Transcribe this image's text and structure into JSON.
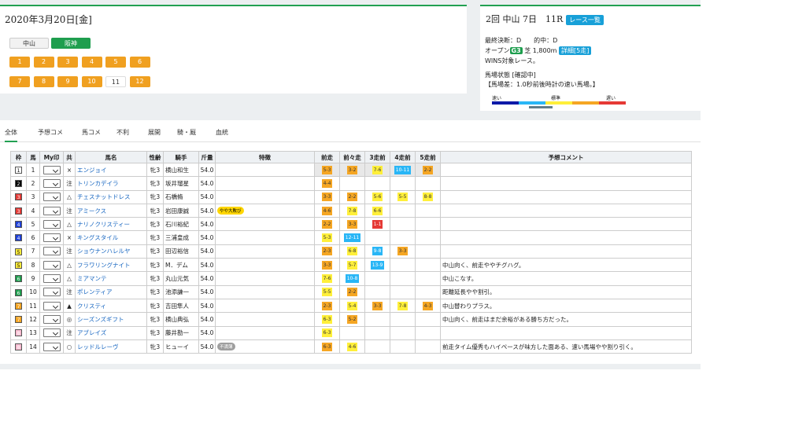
{
  "date": {
    "title": "2020年3月20日[金]"
  },
  "venues": [
    "中山",
    "阪神"
  ],
  "races": [
    "1",
    "2",
    "3",
    "4",
    "5",
    "6",
    "7",
    "8",
    "9",
    "10",
    "11",
    "12"
  ],
  "race": {
    "title": "2回 中山 7日　11R",
    "list_btn": "レース一覧",
    "final": "最終決断：D　　的中：D",
    "open": "オープン",
    "grade": "G3",
    "course": "芝 1,800m",
    "detail": "詳細[5走]",
    "wins": "WINS対象レース。",
    "baba": "馬場状態 [確認中]",
    "baba_note": "【馬場差：1.0秒前後時計の速い馬場。】",
    "scale": [
      "速い",
      "標準",
      "遅い"
    ]
  },
  "tabs": [
    "全体",
    "予想コメ",
    "馬コメ",
    "不利",
    "展開",
    "騎・厩",
    "血統"
  ],
  "headers": [
    "枠",
    "馬",
    "My印",
    "共",
    "馬名",
    "性齢",
    "騎手",
    "斤量",
    "特徴",
    "前走",
    "前々走",
    "3走前",
    "4走前",
    "5走前",
    "予想コメント"
  ],
  "colors": {
    "green": "#1e9e4e",
    "orange": "#f0a020",
    "blue": "#18a0d8"
  },
  "rows": [
    {
      "waku": "1",
      "wc": "#fff",
      "wt": "#000",
      "uma": "1",
      "kyo": "×",
      "name": "エンジョイ",
      "sei": "牝3",
      "jockey": "横山和生",
      "kin": "54.0",
      "feat": "",
      "fc": "",
      "runs": [
        [
          "5-3",
          "#f5a623"
        ],
        [
          "3-2",
          "#f5a623"
        ],
        [
          "7-6",
          "#ffef3a"
        ],
        [
          "10-11",
          "#29b6f6"
        ],
        [
          "2-2",
          "#f5a623"
        ]
      ],
      "cmt": ""
    },
    {
      "waku": "2",
      "wc": "#000",
      "wt": "#fff",
      "uma": "2",
      "kyo": "注",
      "name": "トリンカデイラ",
      "sei": "牝3",
      "jockey": "坂井瑠星",
      "kin": "54.0",
      "feat": "",
      "fc": "",
      "runs": [
        [
          "4-4",
          "#f5a623"
        ],
        [
          "",
          ""
        ],
        [
          "",
          ""
        ],
        [
          "",
          ""
        ],
        [
          "",
          ""
        ]
      ],
      "cmt": ""
    },
    {
      "waku": "3",
      "wc": "#e53935",
      "wt": "#fff",
      "uma": "3",
      "kyo": "△",
      "name": "チェスナットドレス",
      "sei": "牝3",
      "jockey": "石橋脩",
      "kin": "54.0",
      "feat": "",
      "fc": "",
      "runs": [
        [
          "3-3",
          "#f5a623"
        ],
        [
          "2-2",
          "#f5a623"
        ],
        [
          "5-6",
          "#ffef3a"
        ],
        [
          "5-5",
          "#ffef3a"
        ],
        [
          "8-8",
          "#ffef3a"
        ]
      ],
      "cmt": ""
    },
    {
      "waku": "3",
      "wc": "#e53935",
      "wt": "#fff",
      "uma": "4",
      "kyo": "注",
      "name": "アミークス",
      "sei": "牝3",
      "jockey": "岩田康誠",
      "kin": "54.0",
      "feat": "やや大敗び",
      "fc": "#ffd600",
      "runs": [
        [
          "4-6",
          "#f5a623"
        ],
        [
          "7-8",
          "#ffef3a"
        ],
        [
          "6-6",
          "#ffef3a"
        ],
        [
          "",
          ""
        ],
        [
          "",
          ""
        ]
      ],
      "cmt": ""
    },
    {
      "waku": "4",
      "wc": "#1e40d8",
      "wt": "#fff",
      "uma": "5",
      "kyo": "△",
      "name": "ナリノクリスティー",
      "sei": "牝3",
      "jockey": "石川裕紀",
      "kin": "54.0",
      "feat": "",
      "fc": "",
      "runs": [
        [
          "2-2",
          "#f5a623"
        ],
        [
          "3-3",
          "#f5a623"
        ],
        [
          "1-1",
          "#e53935"
        ],
        [
          "",
          ""
        ],
        [
          "",
          ""
        ]
      ],
      "cmt": ""
    },
    {
      "waku": "4",
      "wc": "#1e40d8",
      "wt": "#fff",
      "uma": "6",
      "kyo": "×",
      "name": "キングスタイル",
      "sei": "牝3",
      "jockey": "三浦皇成",
      "kin": "54.0",
      "feat": "",
      "fc": "",
      "runs": [
        [
          "5-3",
          "#ffef3a"
        ],
        [
          "12-11",
          "#29b6f6"
        ],
        [
          "",
          ""
        ],
        [
          "",
          ""
        ],
        [
          "",
          ""
        ]
      ],
      "cmt": ""
    },
    {
      "waku": "5",
      "wc": "#ffeb3b",
      "wt": "#000",
      "uma": "7",
      "kyo": "注",
      "name": "ショウナンハレルヤ",
      "sei": "牝3",
      "jockey": "田辺裕信",
      "kin": "54.0",
      "feat": "",
      "fc": "",
      "runs": [
        [
          "2-3",
          "#f5a623"
        ],
        [
          "6-8",
          "#ffef3a"
        ],
        [
          "9-8",
          "#29b6f6"
        ],
        [
          "3-3",
          "#f5a623"
        ],
        [
          "",
          ""
        ]
      ],
      "cmt": ""
    },
    {
      "waku": "5",
      "wc": "#ffeb3b",
      "wt": "#000",
      "uma": "8",
      "kyo": "△",
      "name": "フラワリングナイト",
      "sei": "牝3",
      "jockey": "M．デム",
      "kin": "54.0",
      "feat": "",
      "fc": "",
      "runs": [
        [
          "3-3",
          "#f5a623"
        ],
        [
          "5-7",
          "#ffef3a"
        ],
        [
          "13-9",
          "#29b6f6"
        ],
        [
          "",
          ""
        ],
        [
          "",
          ""
        ]
      ],
      "cmt": "中山向く、前走ややチグハグ。"
    },
    {
      "waku": "6",
      "wc": "#1e9e4e",
      "wt": "#fff",
      "uma": "9",
      "kyo": "△",
      "name": "ミアマンテ",
      "sei": "牝3",
      "jockey": "丸山元気",
      "kin": "54.0",
      "feat": "",
      "fc": "",
      "runs": [
        [
          "7-6",
          "#ffef3a"
        ],
        [
          "10-8",
          "#29b6f6"
        ],
        [
          "",
          ""
        ],
        [
          "",
          ""
        ],
        [
          "",
          ""
        ]
      ],
      "cmt": "中山こなす。"
    },
    {
      "waku": "6",
      "wc": "#1e9e4e",
      "wt": "#fff",
      "uma": "10",
      "kyo": "注",
      "name": "ポレンティア",
      "sei": "牝3",
      "jockey": "池添謙一",
      "kin": "54.0",
      "feat": "",
      "fc": "",
      "runs": [
        [
          "5-5",
          "#ffef3a"
        ],
        [
          "2-2",
          "#f5a623"
        ],
        [
          "",
          ""
        ],
        [
          "",
          ""
        ],
        [
          "",
          ""
        ]
      ],
      "cmt": "距離延長やや割引。"
    },
    {
      "waku": "7",
      "wc": "#f5a623",
      "wt": "#fff",
      "uma": "11",
      "kyo": "▲",
      "name": "クリスティ",
      "sei": "牝3",
      "jockey": "吉田隼人",
      "kin": "54.0",
      "feat": "",
      "fc": "",
      "runs": [
        [
          "2-3",
          "#f5a623"
        ],
        [
          "5-4",
          "#ffef3a"
        ],
        [
          "3-3",
          "#f5a623"
        ],
        [
          "7-8",
          "#ffef3a"
        ],
        [
          "4-3",
          "#f5a623"
        ]
      ],
      "cmt": "中山替わりプラス。"
    },
    {
      "waku": "7",
      "wc": "#f5a623",
      "wt": "#fff",
      "uma": "12",
      "kyo": "◎",
      "name": "シーズンズギフト",
      "sei": "牝3",
      "jockey": "横山典弘",
      "kin": "54.0",
      "feat": "",
      "fc": "",
      "runs": [
        [
          "6-3",
          "#ffef3a"
        ],
        [
          "5-2",
          "#f5a623"
        ],
        [
          "",
          ""
        ],
        [
          "",
          ""
        ],
        [
          "",
          ""
        ]
      ],
      "cmt": "中山向く、前走はまだ余裕がある勝ち方だった。"
    },
    {
      "waku": "8",
      "wc": "#f8bbd0",
      "wt": "#fff",
      "uma": "13",
      "kyo": "注",
      "name": "アブレイズ",
      "sei": "牝3",
      "jockey": "藤井勘一",
      "kin": "54.0",
      "feat": "",
      "fc": "",
      "runs": [
        [
          "6-3",
          "#ffef3a"
        ],
        [
          "",
          ""
        ],
        [
          "",
          ""
        ],
        [
          "",
          ""
        ],
        [
          "",
          ""
        ]
      ],
      "cmt": ""
    },
    {
      "waku": "8",
      "wc": "#f8bbd0",
      "wt": "#fff",
      "uma": "14",
      "kyo": "○",
      "name": "レッドルレーヴ",
      "sei": "牝3",
      "jockey": "ヒューイ",
      "kin": "54.0",
      "feat": "不満薄",
      "fc": "#9e9e9e",
      "runs": [
        [
          "6-3",
          "#f5a623"
        ],
        [
          "4-6",
          "#ffef3a"
        ],
        [
          "",
          ""
        ],
        [
          "",
          ""
        ],
        [
          "",
          ""
        ]
      ],
      "cmt": "前走タイム優秀もハイペースが味方した面ある、速い馬場やや割り引く。"
    }
  ]
}
